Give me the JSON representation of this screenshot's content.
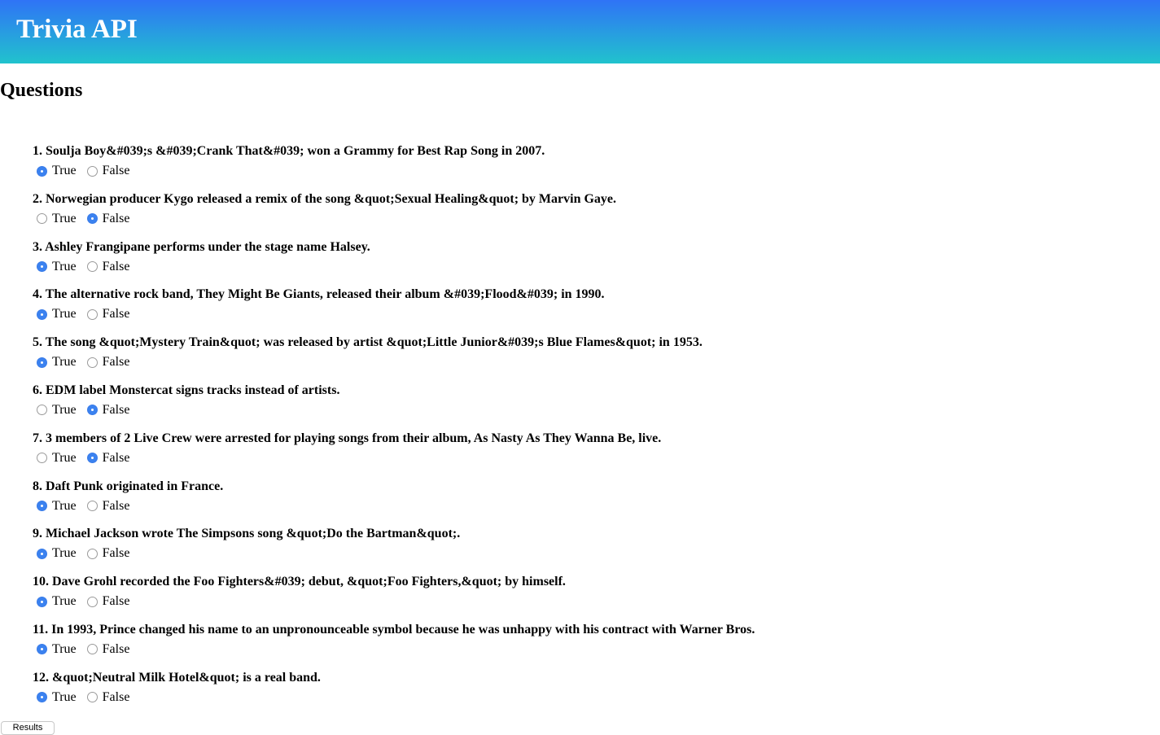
{
  "header": {
    "title": "Trivia API"
  },
  "main": {
    "section_title": "Questions",
    "true_label": "True",
    "false_label": "False",
    "results_label": "Results",
    "questions": [
      {
        "text": "1. Soulja Boy&#039;s &#039;Crank That&#039; won a Grammy for Best Rap Song in 2007.",
        "selected": "True"
      },
      {
        "text": "2. Norwegian producer Kygo released a remix of the song &quot;Sexual Healing&quot; by Marvin Gaye.",
        "selected": "False"
      },
      {
        "text": "3. Ashley Frangipane performs under the stage name Halsey.",
        "selected": "True"
      },
      {
        "text": "4. The alternative rock band, They Might Be Giants, released their album &#039;Flood&#039; in 1990.",
        "selected": "True"
      },
      {
        "text": "5. The song &quot;Mystery Train&quot; was released by artist &quot;Little Junior&#039;s Blue Flames&quot; in 1953.",
        "selected": "True"
      },
      {
        "text": "6. EDM label Monstercat signs tracks instead of artists.",
        "selected": "False"
      },
      {
        "text": "7. 3 members of 2 Live Crew were arrested for playing songs from their album, As Nasty As They Wanna Be, live.",
        "selected": "False"
      },
      {
        "text": "8. Daft Punk originated in France.",
        "selected": "True"
      },
      {
        "text": "9. Michael Jackson wrote The Simpsons song &quot;Do the Bartman&quot;.",
        "selected": "True"
      },
      {
        "text": "10. Dave Grohl recorded the Foo Fighters&#039; debut, &quot;Foo Fighters,&quot; by himself.",
        "selected": "True"
      },
      {
        "text": "11. In 1993, Prince changed his name to an unpronounceable symbol because he was unhappy with his contract with Warner Bros.",
        "selected": "True"
      },
      {
        "text": "12. &quot;Neutral Milk Hotel&quot; is a real band.",
        "selected": "True"
      }
    ]
  },
  "colors": {
    "header_gradient_top": "#2f73f6",
    "header_gradient_bottom": "#21c3cd",
    "radio_checked": "#3b82f0"
  }
}
